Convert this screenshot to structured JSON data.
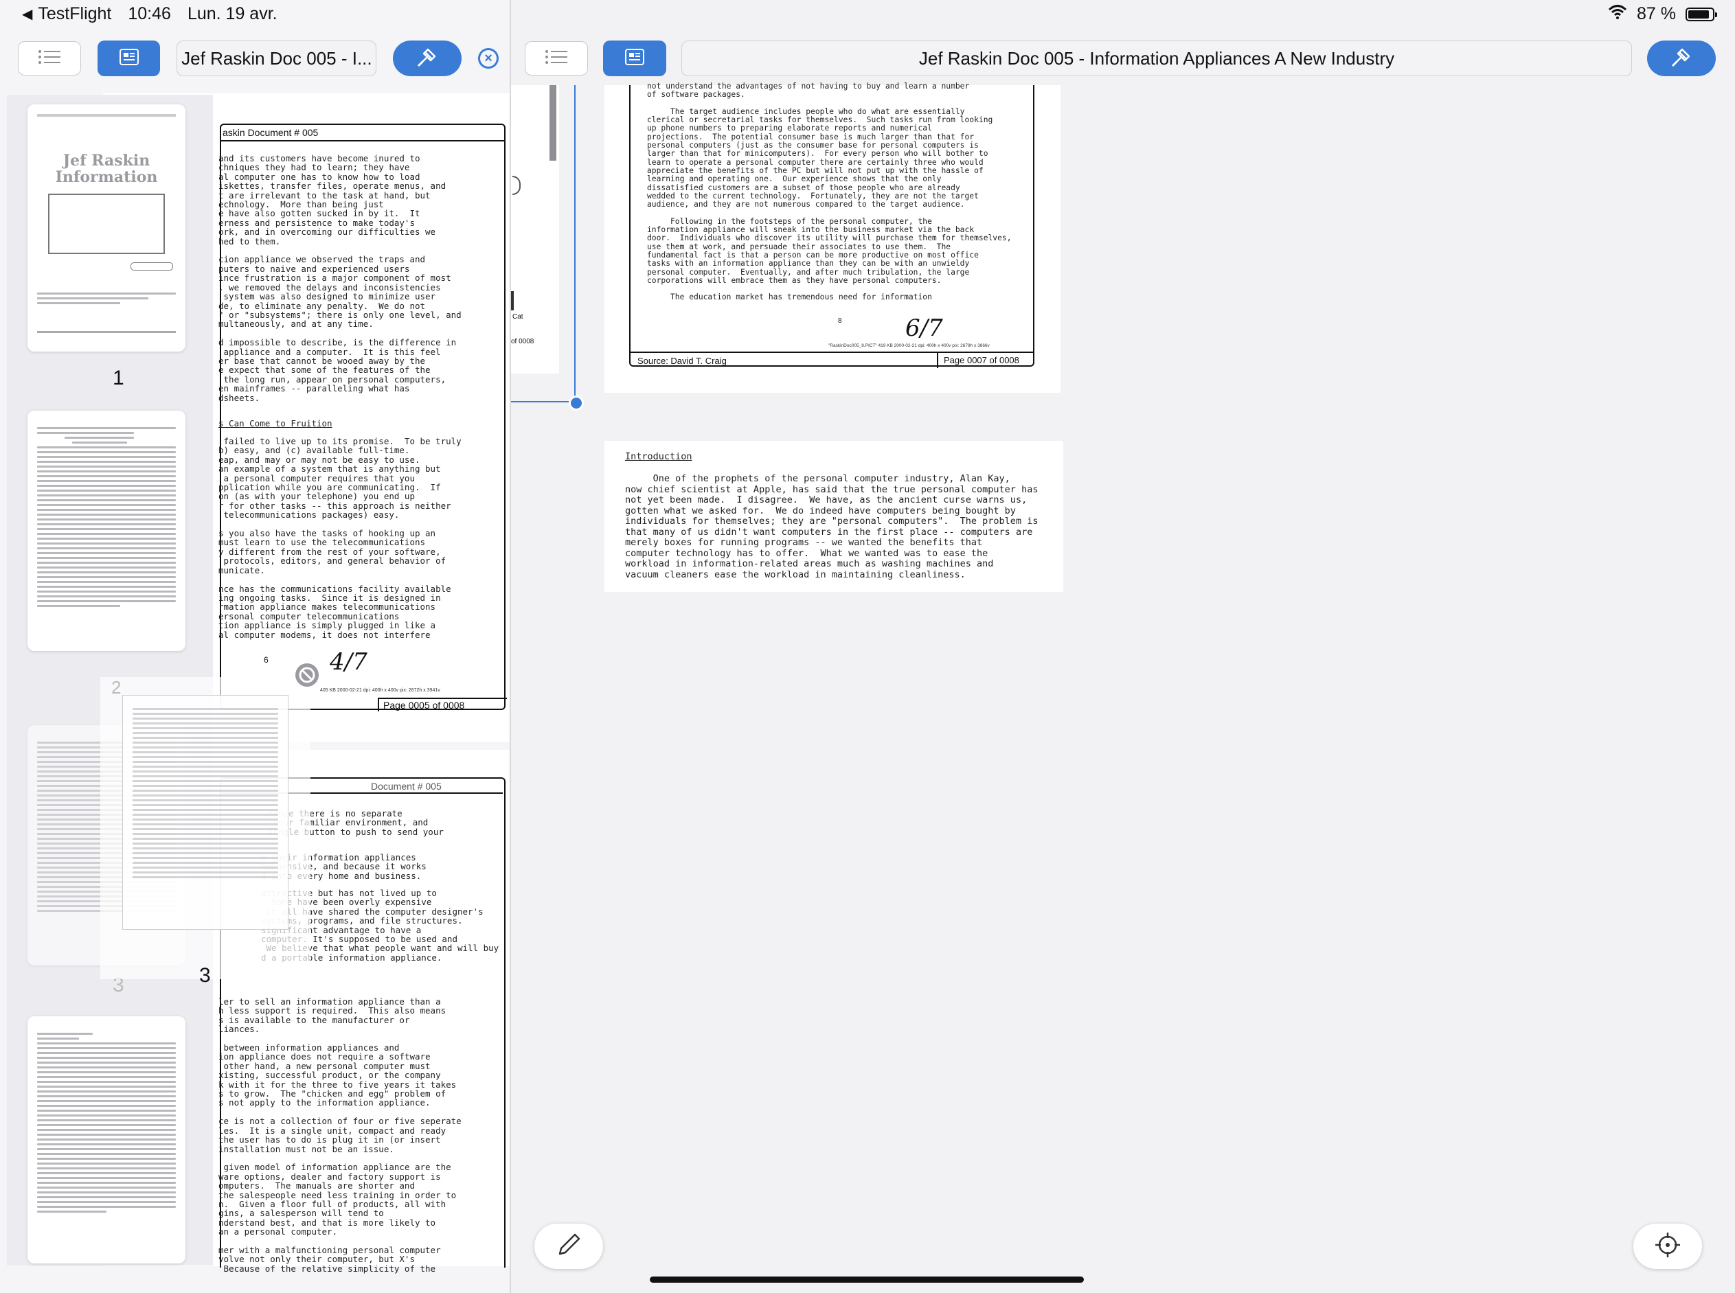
{
  "status_bar": {
    "back_app": "TestFlight",
    "time": "10:46",
    "date": "Lun. 19 avr.",
    "battery": "87 %",
    "battery_level": 0.87
  },
  "left_toolbar": {
    "title": "Jef Raskin Doc 005 - I...",
    "icons": [
      "list-icon",
      "thumbnail-view-icon",
      "tools-icon",
      "close-icon"
    ]
  },
  "right_toolbar": {
    "title": "Jef Raskin Doc 005 - Information Appliances A New Industry",
    "icons": [
      "list-icon",
      "thumbnail-view-icon",
      "tools-icon"
    ]
  },
  "thumbnails": [
    {
      "number": "1",
      "cover_title": "Jef Raskin Information"
    },
    {
      "number": "2"
    },
    {
      "number": "3"
    }
  ],
  "drag_preview": {
    "number": "3",
    "ghost_number_top": "2",
    "ghost_number_bottom": "3"
  },
  "left_page_a": {
    "header": "askin Document # 005",
    "section_heading": "s Can Come to Fruition",
    "page_label": "Page 0005 of 0008",
    "page_number": "6",
    "handwritten": "4/7",
    "meta": "405 KB 2000-02-21 dpi: 400h x 400v pix: 2672h x 3941v",
    "body_1": "and its customers have become inured to\nchniques they had to learn; they have\nal computer one has to know how to load\niskettes, transfer files, operate menus, and\nt are irrelevant to the task at hand, but\nechnology.  More than being just\ne have also gotten sucked in by it.  It\nerness and persistence to make today's\nork, and in overcoming our difficulties we\nhed to them.\n\ncion appliance we observed the traps and\nputers to naive and experienced users\nince frustration is a major component of most\n, we removed the delays and inconsistencies\n system was also designed to minimize user\nde, to eliminate any penalty.  We do not\n\" or \"subsystems\"; there is only one level, and\nmultaneously, and at any time.\n\nd impossible to describe, is the difference in\n appliance and a computer.  It is this feel\ner base that cannot be wooed away by the\ne expect that some of the features of the\n the long run, appear on personal computers,\nen mainframes -- paralleling what has\ndsheets.",
    "body_2": " failed to live up to its promise.  To be truly\nb) easy, and (c) available full-time.\neap, and may or may not be easy to use.\nan example of a system that is anything but\n a personal computer requires that you\npplication while you are communicating.  If\non (as with your telephone) you end up\nr for other tasks -- this approach is neither\n telecommunications packages) easy.\n\ns you also have the tasks of hooking up an\nmust learn to use the telecommunications\ny different from the rest of your software,\n protocols, editors, and general behavior of\nmunicate.\n\nnce has the communications facility available\ning ongoing tasks.  Since it is designed in\nrmation appliance makes telecommunications\nersonal computer telecommunications\ntion appliance is simply plugged in like a\nal computer modems, it does not interfere"
  },
  "left_page_b": {
    "header": "Document # 005",
    "body_1": "Since there is no separate\n your familiar environment, and\nsingle button to push to send your",
    "body_2": "h their information appliances\nnexpensive, and because it works\nd into every home and business.",
    "body_3": "attractive but has not lived up to\n. Some have been overly expensive\n it all have shared the computer designer's\nsystems, programs, and file structures.\nsignificant advantage to have a\ncomputer. It's supposed to be used and\n We believe that what people want and will buy\nd a portable information appliance.",
    "body_4": "ler to sell an information appliance than a\nh less support is required.  This also means\ns is available to the manufacturer or\nliances.\n\n between information appliances and\nion appliance does not require a software\n other hand, a new personal computer must\nxisting, successful product, or the company\nk with it for the three to five years it takes\ns to grow.  The \"chicken and egg\" problem of\ns not apply to the information appliance.\n\nce is not a collection of four or five seperate\nles.  It is a single unit, compact and ready\nthe user has to do is plug it in (or insert\ninstallation must not be an issue.\n\n given model of information appliance are the\nware options, dealer and factory support is\nomputers.  The manuals are shorter and\nthe salespeople need less training in order to\nn.  Given a floor full of products, all with\ngins, a salesperson will tend to\nnderstand best, and that is more likely to\nan a personal computer.\n\nmer with a malfunctioning personal computer\nvolve not only their computer, but X's\n Because of the relative simplicity of the"
  },
  "right_page_7": {
    "body": "not understand the advantages of not having to buy and learn a number\nof software packages.\n\n     The target audience includes people who do what are essentially\nclerical or secretarial tasks for themselves.  Such tasks run from looking\nup phone numbers to preparing elaborate reports and numerical\nprojections.  The potential consumer base is much larger than that for\npersonal computers (just as the consumer base for personal computers is\nlarger than that for minicomputers).  For every person who will bother to\nlearn to operate a personal computer there are certainly three who would\nappreciate the benefits of the PC but will not put up with the hassle of\nlearning and operating one.  Our experience shows that the only\ndissatisfied customers are a subset of those people who are already\nwedded to the current technology.  Fortunately, they are not the target\naudience, and they are not numerous compared to the target audience.\n\n     Following in the footsteps of the personal computer, the\ninformation appliance will sneak into the business market via the back\ndoor.  Individuals who discover its utility will purchase them for themselves,\nuse them at work, and persuade their associates to use them.  The\nfundamental fact is that a person can be more productive on most office\ntasks with an information appliance than they can be with an unwieldy\npersonal computer.  Eventually, and after much tribulation, the large\ncorporations will embrace them as they have personal computers.\n\n     The education market has tremendous need for information",
    "page_number": "8",
    "handwritten": "6/7",
    "meta": "\"RaskinDoc005_8.PICT\" 419 KB 2000-02-21 dpi: 400h x 400v pix: 2679h x 3866v",
    "source": "Source:  David T. Craig",
    "page_label": "Page 0007 of 0008"
  },
  "right_intro": {
    "heading": "Introduction",
    "body": "     One of the prophets of the personal computer industry, Alan Kay,\nnow chief scientist at Apple, has said that the true personal computer has\nnot yet been made.  I disagree.  We have, as the ancient curse warns us,\ngotten what we asked for.  We do indeed have computers being bought by\nindividuals for themselves; they are \"personal computers\".  The problem is\nthat many of us didn't want computers in the first place -- computers are\nmerely boxes for running programs -- we wanted the benefits that\ncomputer technology has to offer.  What we wanted was to ease the\nworkload in information-related areas much as washing machines and\nvacuum cleaners ease the workload in maintaining cleanliness."
  },
  "left_strip": {
    "label": "Cat",
    "page_fragment": "of 0008"
  },
  "colors": {
    "accent": "#3a7bd5",
    "pane_bg": "#f5f5f7",
    "text": "#111111"
  }
}
